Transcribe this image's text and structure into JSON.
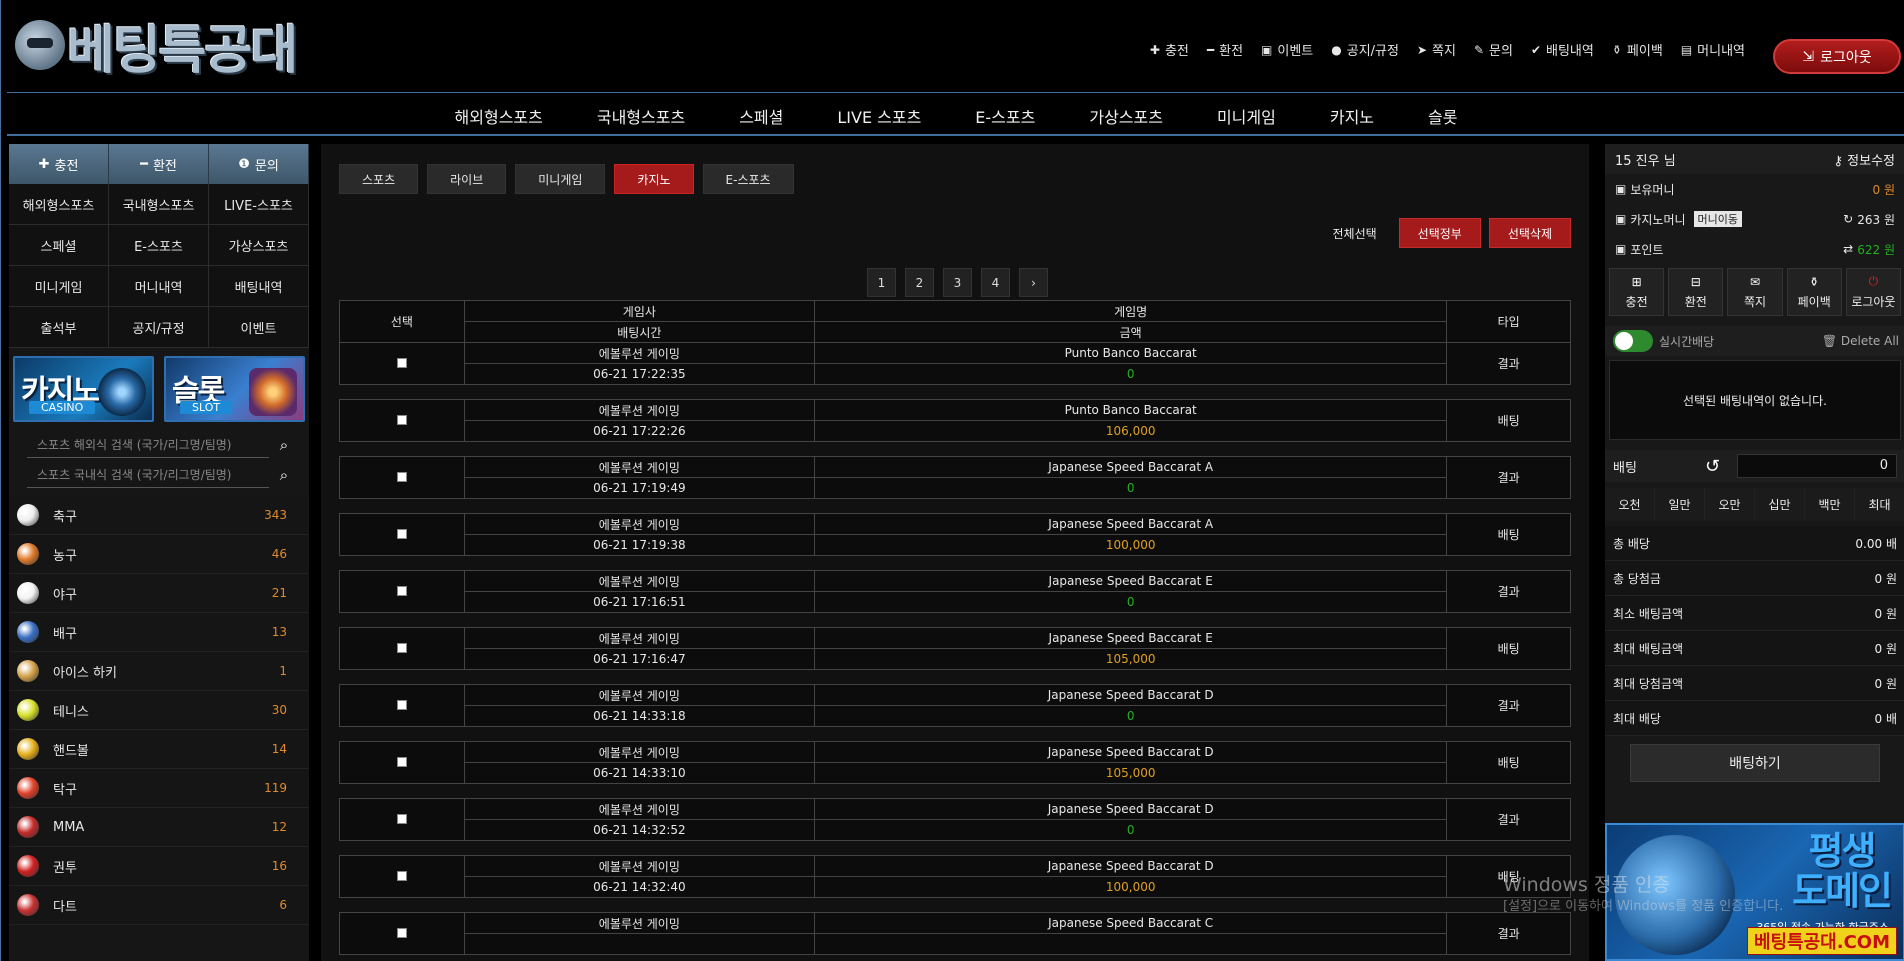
{
  "brand": {
    "logo_text": "베팅특공대"
  },
  "topnav": [
    {
      "icon": "plus-icon",
      "glyph": "✚",
      "label": "충전"
    },
    {
      "icon": "minus-icon",
      "glyph": "━",
      "label": "환전"
    },
    {
      "icon": "calendar-icon",
      "glyph": "▣",
      "label": "이벤트"
    },
    {
      "icon": "info-icon",
      "glyph": "●",
      "label": "공지/규정"
    },
    {
      "icon": "paper-plane-icon",
      "glyph": "➤",
      "label": "쪽지"
    },
    {
      "icon": "edit-icon",
      "glyph": "✎",
      "label": "문의"
    },
    {
      "icon": "check-icon",
      "glyph": "✔",
      "label": "배팅내역"
    },
    {
      "icon": "payback-icon",
      "glyph": "⚱",
      "label": "페이백"
    },
    {
      "icon": "document-icon",
      "glyph": "▤",
      "label": "머니내역"
    }
  ],
  "logout_label": "로그아웃",
  "mainnav": [
    "해외형스포츠",
    "국내형스포츠",
    "스페셜",
    "LIVE 스포츠",
    "E-스포츠",
    "가상스포츠",
    "미니게임",
    "카지노",
    "슬롯"
  ],
  "left": {
    "quick": [
      {
        "icon": "plus-icon",
        "glyph": "✚",
        "label": "충전"
      },
      {
        "icon": "minus-icon",
        "glyph": "━",
        "label": "환전"
      },
      {
        "icon": "info-icon",
        "glyph": "❶",
        "label": "문의"
      }
    ],
    "menu": [
      "해외형스포츠",
      "국내형스포츠",
      "LIVE-스포츠",
      "스페셜",
      "E-스포츠",
      "가상스포츠",
      "미니게임",
      "머니내역",
      "배팅내역",
      "출석부",
      "공지/규정",
      "이벤트"
    ],
    "banners": [
      {
        "title": "카지노",
        "sub": "CASINO"
      },
      {
        "title": "슬롯",
        "sub": "SLOT"
      }
    ],
    "search_foreign": "스포츠 해외식 검색 (국가/리그명/팀명)",
    "search_domestic": "스포츠 국내식 검색 (국가/리그명/팀명)",
    "sports": [
      {
        "name": "축구",
        "count": "343",
        "color": "#eeeeee"
      },
      {
        "name": "농구",
        "count": "46",
        "color": "#e07a2a"
      },
      {
        "name": "야구",
        "count": "21",
        "color": "#f2f2f2"
      },
      {
        "name": "배구",
        "count": "13",
        "color": "#3a6fc4"
      },
      {
        "name": "아이스 하키",
        "count": "1",
        "color": "#d4a24a"
      },
      {
        "name": "테니스",
        "count": "30",
        "color": "#d6e02a"
      },
      {
        "name": "핸드볼",
        "count": "14",
        "color": "#e6b01a"
      },
      {
        "name": "탁구",
        "count": "119",
        "color": "#e0402a"
      },
      {
        "name": "MMA",
        "count": "12",
        "color": "#c42a2a"
      },
      {
        "name": "권투",
        "count": "16",
        "color": "#d02020"
      },
      {
        "name": "다트",
        "count": "6",
        "color": "#c83030"
      }
    ]
  },
  "center": {
    "tabs": [
      {
        "label": "스포츠",
        "active": false
      },
      {
        "label": "라이브",
        "active": false
      },
      {
        "label": "미니게임",
        "active": false
      },
      {
        "label": "카지노",
        "active": true
      },
      {
        "label": "E-스포츠",
        "active": false
      }
    ],
    "select_all": "전체선택",
    "btn_select_all": "선택정부",
    "btn_delete": "선택삭제",
    "pages": [
      "1",
      "2",
      "3",
      "4",
      "›"
    ],
    "headers": {
      "select": "선택",
      "provider": "게임사",
      "game": "게임명",
      "type": "타입",
      "time": "배팅시간",
      "amount": "금액"
    },
    "rows": [
      {
        "provider": "에볼루션 게이밍",
        "time": "06-21 17:22:35",
        "game": "Punto Banco Baccarat",
        "amount": "0",
        "type": "결과"
      },
      {
        "provider": "에볼루션 게이밍",
        "time": "06-21 17:22:26",
        "game": "Punto Banco Baccarat",
        "amount": "106,000",
        "type": "배팅"
      },
      {
        "provider": "에볼루션 게이밍",
        "time": "06-21 17:19:49",
        "game": "Japanese Speed Baccarat A",
        "amount": "0",
        "type": "결과"
      },
      {
        "provider": "에볼루션 게이밍",
        "time": "06-21 17:19:38",
        "game": "Japanese Speed Baccarat A",
        "amount": "100,000",
        "type": "배팅"
      },
      {
        "provider": "에볼루션 게이밍",
        "time": "06-21 17:16:51",
        "game": "Japanese Speed Baccarat E",
        "amount": "0",
        "type": "결과"
      },
      {
        "provider": "에볼루션 게이밍",
        "time": "06-21 17:16:47",
        "game": "Japanese Speed Baccarat E",
        "amount": "105,000",
        "type": "배팅"
      },
      {
        "provider": "에볼루션 게이밍",
        "time": "06-21 14:33:18",
        "game": "Japanese Speed Baccarat D",
        "amount": "0",
        "type": "결과"
      },
      {
        "provider": "에볼루션 게이밍",
        "time": "06-21 14:33:10",
        "game": "Japanese Speed Baccarat D",
        "amount": "105,000",
        "type": "배팅"
      },
      {
        "provider": "에볼루션 게이밍",
        "time": "06-21 14:32:52",
        "game": "Japanese Speed Baccarat D",
        "amount": "0",
        "type": "결과"
      },
      {
        "provider": "에볼루션 게이밍",
        "time": "06-21 14:32:40",
        "game": "Japanese Speed Baccarat D",
        "amount": "100,000",
        "type": "배팅"
      },
      {
        "provider": "에볼루션 게이밍",
        "time": "",
        "game": "Japanese Speed Baccarat C",
        "amount": "",
        "type": "결과"
      }
    ]
  },
  "right": {
    "user": "15  진우 님",
    "edit_info": "정보수정",
    "money_label": "보유머니",
    "money_value": "0 원",
    "casino_label": "카지노머니",
    "casino_move": "머니이동",
    "casino_value": "263 원",
    "point_label": "포인트",
    "point_value": "622 원",
    "buttons": [
      {
        "icon": "plus-box-icon",
        "glyph": "⊞",
        "label": "충전"
      },
      {
        "icon": "minus-box-icon",
        "glyph": "⊟",
        "label": "환전"
      },
      {
        "icon": "mail-icon",
        "glyph": "✉",
        "label": "쪽지"
      },
      {
        "icon": "payback-icon",
        "glyph": "⚱",
        "label": "페이백"
      },
      {
        "icon": "power-icon",
        "glyph": "⏻",
        "label": "로그아웃"
      }
    ],
    "live_label": "실시간배당",
    "delete_all": "Delete All",
    "empty_msg": "선택된 배팅내역이 없습니다.",
    "bet_label": "배팅",
    "bet_value": "0",
    "amounts": [
      "오천",
      "일만",
      "오만",
      "십만",
      "백만",
      "최대"
    ],
    "summary": [
      {
        "label": "총 배당",
        "value": "0.00 배"
      },
      {
        "label": "총 당첨금",
        "value": "0 원"
      },
      {
        "label": "최소 배팅금액",
        "value": "0 원"
      },
      {
        "label": "최대 배팅금액",
        "value": "0 원"
      },
      {
        "label": "최대 당첨금액",
        "value": "0 원"
      },
      {
        "label": "최대 배당",
        "value": "0 배"
      }
    ],
    "bet_button": "배팅하기",
    "promo": {
      "title1": "평생",
      "title2": "도메인",
      "sub": "365일 접속 가능한 한글주소",
      "url": "베팅특공대.COM"
    }
  },
  "watermark": {
    "line1": "Windows 정품 인증",
    "line2": "[설정]으로 이동하여 Windows를 정품 인증합니다."
  }
}
